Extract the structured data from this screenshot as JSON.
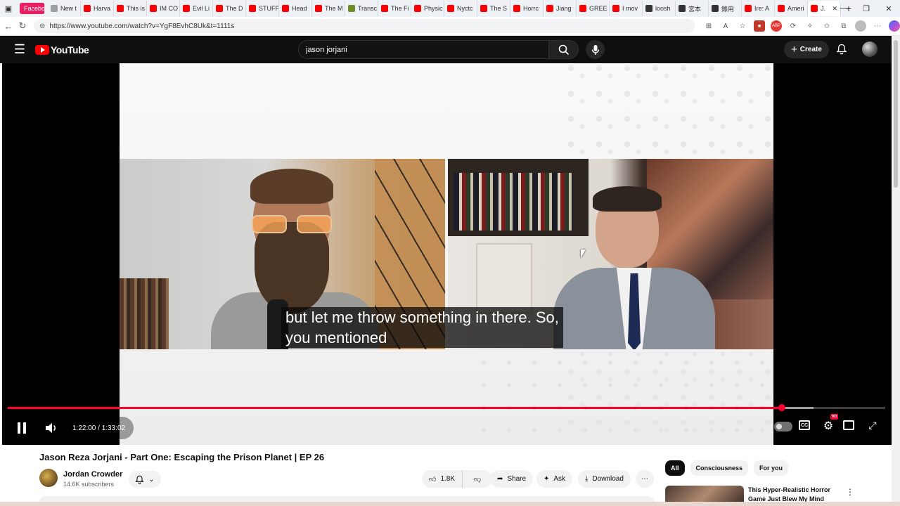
{
  "browser": {
    "tabs": [
      {
        "label": "Facebo",
        "color": "#e91e63"
      },
      {
        "label": "New t",
        "color": "#9aa0a6"
      },
      {
        "label": "Harva",
        "color": "#ff0000"
      },
      {
        "label": "This is",
        "color": "#ff0000"
      },
      {
        "label": "IM CO",
        "color": "#ff0000"
      },
      {
        "label": "Evil Li",
        "color": "#ff0000"
      },
      {
        "label": "The D",
        "color": "#ff0000"
      },
      {
        "label": "STUFF",
        "color": "#ff0000"
      },
      {
        "label": "Head",
        "color": "#ff0000"
      },
      {
        "label": "The M",
        "color": "#ff0000"
      },
      {
        "label": "Transc",
        "color": "#6b8e23"
      },
      {
        "label": "The Fi",
        "color": "#ff0000"
      },
      {
        "label": "Physic",
        "color": "#ff0000"
      },
      {
        "label": "Nyctc",
        "color": "#ff0000"
      },
      {
        "label": "The S",
        "color": "#ff0000"
      },
      {
        "label": "Horrc",
        "color": "#ff0000"
      },
      {
        "label": "Jiang",
        "color": "#ff0000"
      },
      {
        "label": "GREE",
        "color": "#ff0000"
      },
      {
        "label": "I mov",
        "color": "#ff0000"
      },
      {
        "label": "loosh",
        "color": "#333333"
      },
      {
        "label": "宮本",
        "color": "#333333"
      },
      {
        "label": "錄用",
        "color": "#333333"
      },
      {
        "label": "Ire: A",
        "color": "#ff0000"
      },
      {
        "label": "Ameri",
        "color": "#ff0000"
      },
      {
        "label": "J.",
        "color": "#ff0000"
      }
    ],
    "url": "https://www.youtube.com/watch?v=YgF8EvhC8Uk&t=1111s"
  },
  "header": {
    "logo_text": "YouTube",
    "search_value": "jason jorjani",
    "create_label": "Create"
  },
  "player": {
    "caption_line1": "but let me throw something in there. So,",
    "caption_line2": "you mentioned",
    "time_text": "1:22:00 / 1:33:02",
    "progress_fraction": 0.882,
    "buffer_fraction": 0.918,
    "hd_badge": "HD",
    "cc_label": "CC"
  },
  "video": {
    "title": "Jason Reza Jorjani - Part One: Escaping the Prison Planet | EP 26",
    "channel_name": "Jordan Crowder",
    "subscribers": "14.6K subscribers",
    "likes": "1.8K",
    "share_label": "Share",
    "ask_label": "Ask",
    "download_label": "Download"
  },
  "sidebar": {
    "chips": [
      {
        "label": "All",
        "active": true
      },
      {
        "label": "Consciousness",
        "active": false
      },
      {
        "label": "For you",
        "active": false
      }
    ],
    "rec_title": "This Hyper-Realistic Horror Game Just Blew My Mind"
  },
  "colors": {
    "accent_red": "#ff0033",
    "yt_dark": "#0f0f0f"
  }
}
